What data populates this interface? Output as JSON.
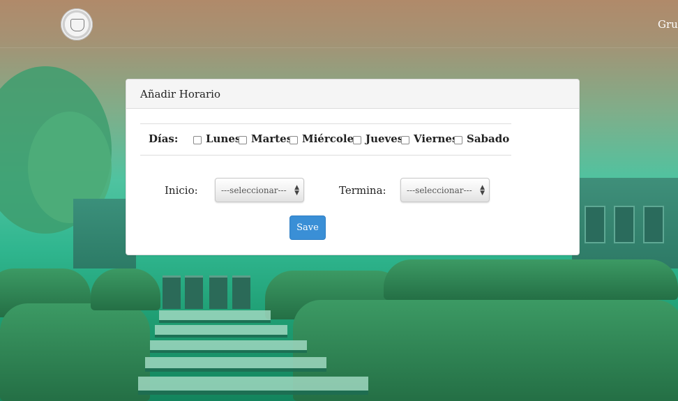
{
  "nav": {
    "brand_text": "Grup"
  },
  "panel": {
    "title": "Añadir Horario",
    "days_label": "Días:",
    "days": [
      "Lunes",
      "Martes",
      "Miércoles",
      "Jueves",
      "Viernes",
      "Sabado"
    ],
    "start_label": "Inicio:",
    "start_select_value": "---seleccionar---",
    "end_label": "Termina:",
    "end_select_value": "---seleccionar---",
    "save_label": "Save"
  },
  "colors": {
    "primary_button": "#3a8fd6",
    "panel_heading": "#f5f5f5",
    "background_accent": "#2db08c"
  }
}
